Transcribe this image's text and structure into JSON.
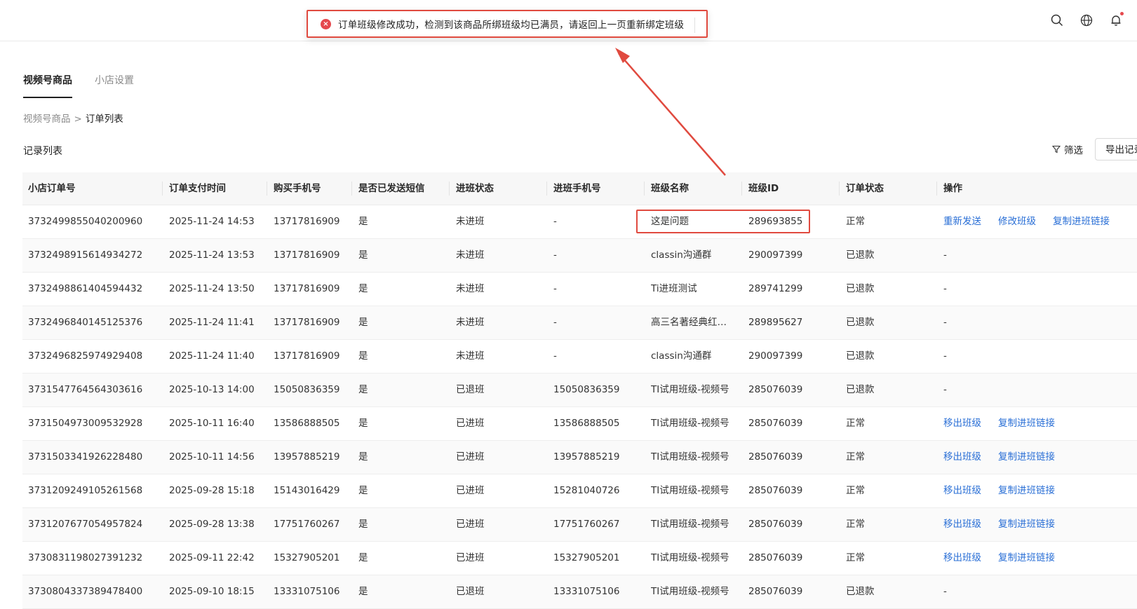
{
  "toast": {
    "message": "订单班级修改成功，检测到该商品所绑班级均已满员，请返回上一页重新绑定班级",
    "icon": "error-circle-icon"
  },
  "topbar": {
    "icons": [
      "search-icon",
      "globe-icon",
      "bell-icon"
    ]
  },
  "tabs": [
    {
      "label": "视频号商品",
      "active": true
    },
    {
      "label": "小店设置",
      "active": false
    }
  ],
  "breadcrumb": {
    "parent": "视频号商品",
    "separator": ">",
    "current": "订单列表"
  },
  "section": {
    "title": "记录列表",
    "filter_label": "筛选",
    "export_label": "导出记录"
  },
  "table": {
    "headers": [
      "小店订单号",
      "订单支付时间",
      "购买手机号",
      "是否已发送短信",
      "进班状态",
      "进班手机号",
      "班级名称",
      "班级ID",
      "订单状态",
      "操作"
    ],
    "rows": [
      {
        "order": "3732499855040200960",
        "time": "2025-11-24 14:53",
        "buyer": "13717816909",
        "sms": "是",
        "enroll": "未进班",
        "enroll_phone": "-",
        "class_name": "这是问题",
        "class_id": "289693855",
        "status": "正常",
        "ops": [
          "重新发送",
          "修改班级",
          "复制进班链接"
        ]
      },
      {
        "order": "3732498915614934272",
        "time": "2025-11-24 13:53",
        "buyer": "13717816909",
        "sms": "是",
        "enroll": "未进班",
        "enroll_phone": "-",
        "class_name": "classin沟通群",
        "class_id": "290097399",
        "status": "已退款",
        "ops": [],
        "ops_text": "-"
      },
      {
        "order": "3732498861404594432",
        "time": "2025-11-24 13:50",
        "buyer": "13717816909",
        "sms": "是",
        "enroll": "未进班",
        "enroll_phone": "-",
        "class_name": "Ti进班测试",
        "class_id": "289741299",
        "status": "已退款",
        "ops": [],
        "ops_text": "-"
      },
      {
        "order": "3732496840145125376",
        "time": "2025-11-24 11:41",
        "buyer": "13717816909",
        "sms": "是",
        "enroll": "未进班",
        "enroll_phone": "-",
        "class_name": "高三名著经典红…",
        "class_id": "289895627",
        "status": "已退款",
        "ops": [],
        "ops_text": "-"
      },
      {
        "order": "3732496825974929408",
        "time": "2025-11-24 11:40",
        "buyer": "13717816909",
        "sms": "是",
        "enroll": "未进班",
        "enroll_phone": "-",
        "class_name": "classin沟通群",
        "class_id": "290097399",
        "status": "已退款",
        "ops": [],
        "ops_text": "-"
      },
      {
        "order": "3731547764564303616",
        "time": "2025-10-13 14:00",
        "buyer": "15050836359",
        "sms": "是",
        "enroll": "已退班",
        "enroll_phone": "15050836359",
        "class_name": "TI试用班级-视频号",
        "class_id": "285076039",
        "status": "已退款",
        "ops": [],
        "ops_text": "-"
      },
      {
        "order": "3731504973009532928",
        "time": "2025-10-11 16:40",
        "buyer": "13586888505",
        "sms": "是",
        "enroll": "已进班",
        "enroll_phone": "13586888505",
        "class_name": "TI试用班级-视频号",
        "class_id": "285076039",
        "status": "正常",
        "ops": [
          "移出班级",
          "复制进班链接"
        ]
      },
      {
        "order": "3731503341926228480",
        "time": "2025-10-11 14:56",
        "buyer": "13957885219",
        "sms": "是",
        "enroll": "已进班",
        "enroll_phone": "13957885219",
        "class_name": "TI试用班级-视频号",
        "class_id": "285076039",
        "status": "正常",
        "ops": [
          "移出班级",
          "复制进班链接"
        ]
      },
      {
        "order": "3731209249105261568",
        "time": "2025-09-28 15:18",
        "buyer": "15143016429",
        "sms": "是",
        "enroll": "已进班",
        "enroll_phone": "15281040726",
        "class_name": "TI试用班级-视频号",
        "class_id": "285076039",
        "status": "正常",
        "ops": [
          "移出班级",
          "复制进班链接"
        ]
      },
      {
        "order": "3731207677054957824",
        "time": "2025-09-28 13:38",
        "buyer": "17751760267",
        "sms": "是",
        "enroll": "已进班",
        "enroll_phone": "17751760267",
        "class_name": "TI试用班级-视频号",
        "class_id": "285076039",
        "status": "正常",
        "ops": [
          "移出班级",
          "复制进班链接"
        ]
      },
      {
        "order": "3730831198027391232",
        "time": "2025-09-11 22:42",
        "buyer": "15327905201",
        "sms": "是",
        "enroll": "已进班",
        "enroll_phone": "15327905201",
        "class_name": "TI试用班级-视频号",
        "class_id": "285076039",
        "status": "正常",
        "ops": [
          "移出班级",
          "复制进班链接"
        ]
      },
      {
        "order": "3730804337389478400",
        "time": "2025-09-10 18:15",
        "buyer": "13331075106",
        "sms": "是",
        "enroll": "已退班",
        "enroll_phone": "13331075106",
        "class_name": "TI试用班级-视频号",
        "class_id": "285076039",
        "status": "已退款",
        "ops": [],
        "ops_text": "-"
      }
    ]
  },
  "colors": {
    "link": "#2a6fd6",
    "annotation": "#e04a3f",
    "error": "#e5484d"
  }
}
